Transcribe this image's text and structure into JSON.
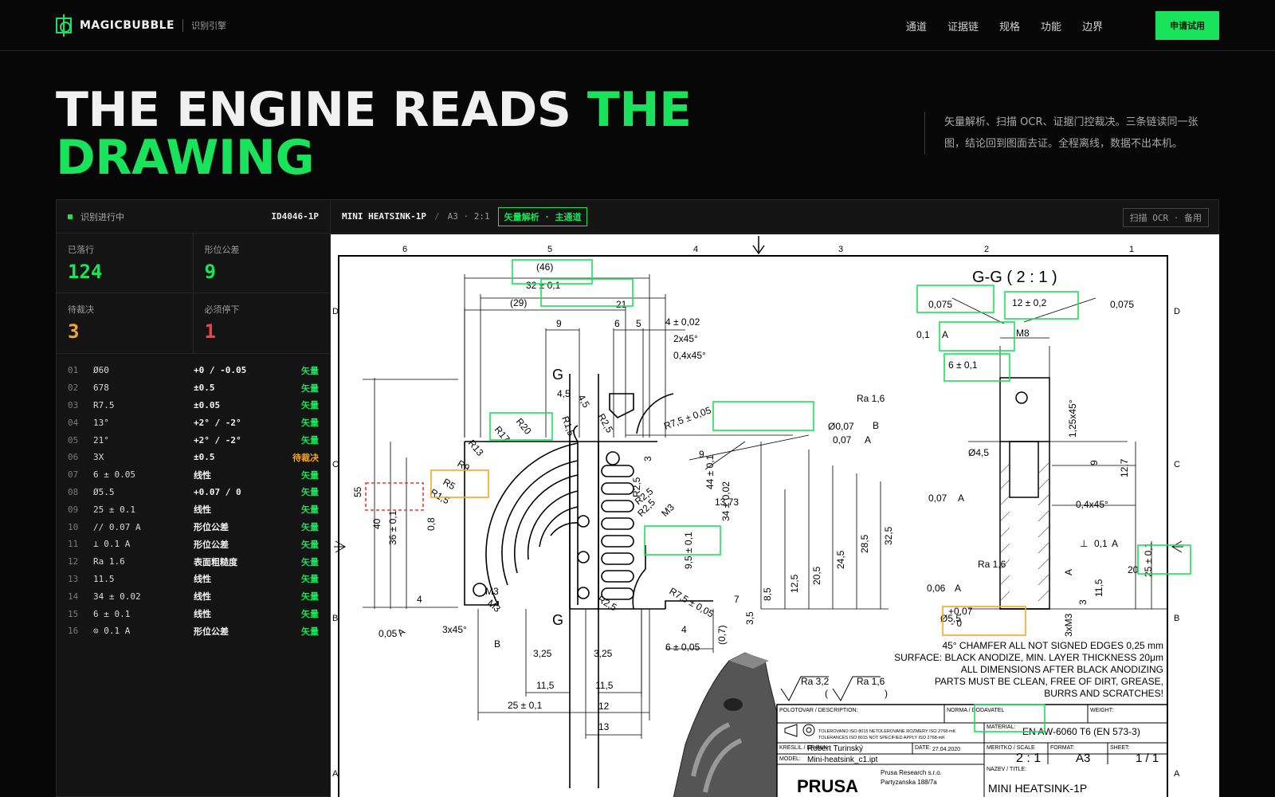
{
  "nav": {
    "brand": "MAGICBUBBLE",
    "brand_sub": "识别引擎",
    "links": [
      "通道",
      "证据链",
      "规格",
      "功能",
      "边界"
    ],
    "cta": "申请试用"
  },
  "hero": {
    "title_white": "THE ENGINE READS ",
    "title_accent": "THE DRAWING",
    "description": "矢量解析、扫描 OCR、证据门控裁决。三条链读同一张图，结论回到图面去证。全程离线，数据不出本机。"
  },
  "colors": {
    "accent": "#19e35a",
    "pending": "#f5a623",
    "stop": "#ff3b3b",
    "box_green": "#19e35a",
    "box_amber": "#f5a623",
    "box_red": "#e53935"
  },
  "panel": {
    "status": "识别进行中",
    "doc_id": "ID4046-1P",
    "stats": [
      {
        "label": "已落行",
        "value": "124",
        "tone": "accent"
      },
      {
        "label": "形位公差",
        "value": "9",
        "tone": "accent"
      },
      {
        "label": "待裁决",
        "value": "3",
        "tone": "pending"
      },
      {
        "label": "必须停下",
        "value": "1",
        "tone": "stop"
      }
    ],
    "rows": [
      {
        "idx": "01",
        "feature": "Ø60",
        "tolerance": "+0 / -0.05",
        "chain": "矢量",
        "tone": "accent"
      },
      {
        "idx": "02",
        "feature": "678",
        "tolerance": "±0.5",
        "chain": "矢量",
        "tone": "accent"
      },
      {
        "idx": "03",
        "feature": "R7.5",
        "tolerance": "±0.05",
        "chain": "矢量",
        "tone": "accent"
      },
      {
        "idx": "04",
        "feature": "13°",
        "tolerance": "+2° / -2°",
        "chain": "矢量",
        "tone": "accent"
      },
      {
        "idx": "05",
        "feature": "21°",
        "tolerance": "+2° / -2°",
        "chain": "矢量",
        "tone": "accent"
      },
      {
        "idx": "06",
        "feature": "3X",
        "tolerance": "±0.5",
        "chain": "待裁决",
        "tone": "pending"
      },
      {
        "idx": "07",
        "feature": "6 ± 0.05",
        "tolerance": "线性",
        "chain": "矢量",
        "tone": "accent"
      },
      {
        "idx": "08",
        "feature": "Ø5.5",
        "tolerance": "+0.07 / 0",
        "chain": "矢量",
        "tone": "accent"
      },
      {
        "idx": "09",
        "feature": "25 ± 0.1",
        "tolerance": "线性",
        "chain": "矢量",
        "tone": "accent"
      },
      {
        "idx": "10",
        "feature": "// 0.07 A",
        "tolerance": "形位公差",
        "chain": "矢量",
        "tone": "accent"
      },
      {
        "idx": "11",
        "feature": "⊥ 0.1 A",
        "tolerance": "形位公差",
        "chain": "矢量",
        "tone": "accent"
      },
      {
        "idx": "12",
        "feature": "Ra 1.6",
        "tolerance": "表面粗糙度",
        "chain": "矢量",
        "tone": "accent"
      },
      {
        "idx": "13",
        "feature": "11.5",
        "tolerance": "线性",
        "chain": "矢量",
        "tone": "accent"
      },
      {
        "idx": "14",
        "feature": "34 ± 0.02",
        "tolerance": "线性",
        "chain": "矢量",
        "tone": "accent"
      },
      {
        "idx": "15",
        "feature": "6 ± 0.1",
        "tolerance": "线性",
        "chain": "矢量",
        "tone": "accent"
      },
      {
        "idx": "16",
        "feature": "⊙ 0.1 A",
        "tolerance": "形位公差",
        "chain": "矢量",
        "tone": "accent"
      }
    ]
  },
  "drawing": {
    "title": "MINI HEATSINK-1P",
    "meta": "A3 · 2:1",
    "channel_tag": "矢量解析 · 主通道",
    "alt_channel": "扫描 OCR · 备用",
    "col_labels": [
      "6",
      "5",
      "4",
      "3",
      "2",
      "1"
    ],
    "row_labels": [
      "D",
      "C",
      "B",
      "A"
    ],
    "section_label": "G-G ( 2 : 1 )",
    "section_marker": "G",
    "dims": [
      "(46)",
      "32 ± 0,1",
      "(29)",
      "21",
      "9",
      "6",
      "5",
      "4 ± 0,02",
      "2x45°",
      "0,4x45°",
      "4,5",
      "4,5",
      "R2,5",
      "R1,5",
      "R20",
      "R17",
      "R13",
      "R9",
      "R5",
      "R1,5",
      "55",
      "40",
      "36 ± 0,1",
      "0,8",
      "4",
      "M3",
      "R2,5",
      "R7,5 ± 0,05",
      "9",
      "13,73",
      "44 ± 0,1",
      "34 ± 0,02",
      "9,5 ± 0,1",
      "3",
      "R2,5",
      "R2,5",
      "M3",
      "R7,5 ± 0,05",
      "7",
      "8,5",
      "12,5",
      "20,5",
      "24,5",
      "28,5",
      "32,5",
      "3x45°",
      "B",
      "4",
      "6 ± 0,05",
      "3,25",
      "3,25",
      "11,5",
      "11,5",
      "25 ± 0,1",
      "12",
      "13",
      "(0,7)",
      "3,5",
      "Ra 1,6",
      "Ø0,07",
      "B",
      "0,07",
      "A",
      "0,05",
      "A",
      "R2,5",
      "M3"
    ],
    "section_dims": [
      "0,075",
      "12 ± 0,2",
      "0,075",
      "0,1",
      "A",
      "M8",
      "6 ± 0,1",
      "1,25x45°",
      "Ø4,5",
      "9",
      "12,7",
      "0,07",
      "A",
      "0,4x45°",
      "⊥",
      "0,1",
      "A",
      "20",
      "25 ± 0,1",
      "A",
      "Ra 1,6",
      "0,06",
      "A",
      "11,5",
      "3",
      "3xM3",
      "Ø5,5",
      "+0,07",
      "- 0"
    ],
    "notes": [
      "45° CHAMFER ALL NOT SIGNED EDGES 0,25 mm",
      "SURFACE: BLACK ANODIZE, MIN. LAYER THICKNESS 20μm",
      "ALL DIMENSIONS AFTER BLACK ANODIZING",
      "PARTS MUST BE CLEAN, FREE OF DIRT, GREASE,",
      "BURRS AND SCRATCHES!"
    ],
    "surface_marks": [
      "Ra 3,2",
      "(",
      "Ra 1,6",
      ")"
    ],
    "titleblock": {
      "blank_label": "POLOTOVAR / DESCRIPTION:",
      "norm_label": "NORMA / DODAVATEL",
      "weight_label": "WEIGHT:",
      "tol_line1": "TOLEROVANO ISO 8015 NETOLEROVANE ROZMERY ISO 2768-mK",
      "tol_line2": "TOLERANCES ISO 8015 NOT SPECIFIED APPLY ISO 2768-mK",
      "material_label": "MATERIAL:",
      "material": "EN AW-6060 T6 (EN 573-3)",
      "drawn_label": "KRESLIL / DRAWN:",
      "drawn": "Robert Turinský",
      "date_label": "DATE:",
      "date": "27.04.2020",
      "scale_label": "MERITKO / SCALE",
      "scale": "2 : 1",
      "format_label": "FORMAT:",
      "format": "A3",
      "sheet_label": "SHEET:",
      "sheet": "1 / 1",
      "model_label": "MODEL:",
      "model": "Mini-heatsink_c1.ipt",
      "company": "PRUSA",
      "company_line1": "Prusa Research s.r.o.",
      "company_line2": "Partyzanska 188/7a",
      "title_label": "NAZEV / TITLE:",
      "title": "MINI HEATSINK-1P"
    }
  }
}
